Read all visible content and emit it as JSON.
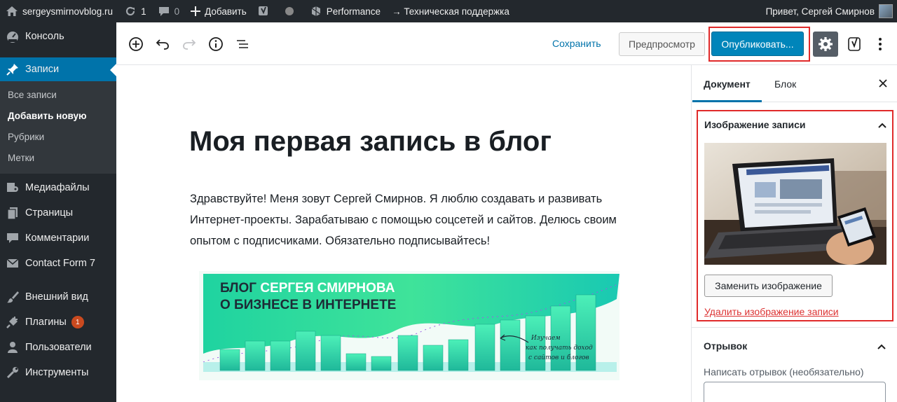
{
  "adminbar": {
    "site_name": "sergeysmirnovblog.ru",
    "updates_count": "1",
    "comments_count": "0",
    "add_label": "Добавить",
    "performance_label": "Performance",
    "support_label": "→ Техническая поддержка",
    "greeting": "Привет, Сергей Смирнов"
  },
  "sidebar": {
    "items": [
      {
        "label": "Консоль",
        "icon": "dashboard-icon"
      },
      {
        "label": "Записи",
        "icon": "pin-icon",
        "active": true
      },
      {
        "label": "Медиафайлы",
        "icon": "media-icon"
      },
      {
        "label": "Страницы",
        "icon": "pages-icon"
      },
      {
        "label": "Комментарии",
        "icon": "comment-icon"
      },
      {
        "label": "Contact Form 7",
        "icon": "mail-icon"
      },
      {
        "label": "Внешний вид",
        "icon": "brush-icon"
      },
      {
        "label": "Плагины",
        "icon": "plugin-icon",
        "badge": "1"
      },
      {
        "label": "Пользователи",
        "icon": "users-icon"
      },
      {
        "label": "Инструменты",
        "icon": "tools-icon"
      }
    ],
    "submenu": [
      "Все записи",
      "Добавить новую",
      "Рубрики",
      "Метки"
    ]
  },
  "toolbar": {
    "save_label": "Сохранить",
    "preview_label": "Предпросмотр",
    "publish_label": "Опубликовать..."
  },
  "post": {
    "title": "Моя первая запись в блог",
    "body": "Здравствуйте! Меня зовут Сергей Смирнов. Я люблю создавать и развивать Интернет-проекты. Зарабатываю с помощью соцсетей и сайтов. Делюсь своим опытом с подписчиками. Обязательно подписывайтесь!",
    "banner": {
      "line1_a": "БЛОГ ",
      "line1_b": "СЕРГЕЯ СМИРНОВА",
      "line2": "О БИЗНЕСЕ В ИНТЕРНЕТЕ",
      "note_1": "Изучаем",
      "note_2": "как получать доход",
      "note_3": "с сайтов и блогов"
    }
  },
  "panel": {
    "tab_document": "Документ",
    "tab_block": "Блок",
    "featured_title": "Изображение записи",
    "replace_label": "Заменить изображение",
    "remove_label": "Удалить изображение записи",
    "excerpt_title": "Отрывок",
    "excerpt_label": "Написать отрывок (необязательно)"
  },
  "colors": {
    "admin_dark": "#23282d",
    "accent_blue": "#0073aa",
    "publish_blue": "#0085ba",
    "highlight_red": "#e02a2a",
    "banner_green": "#2fd898"
  }
}
